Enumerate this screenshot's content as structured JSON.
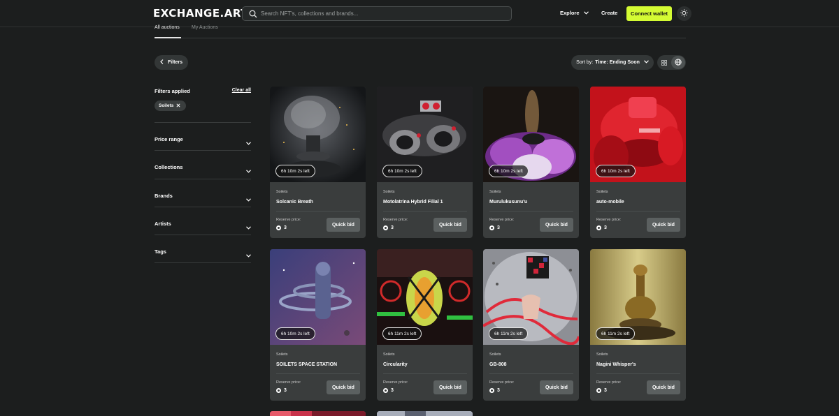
{
  "header": {
    "logo": "EXCHANGE.ART",
    "search_placeholder": "Search NFT's, collections and brands...",
    "nav_explore": "Explore",
    "nav_create": "Create",
    "connect_wallet": "Connect wallet",
    "icons": [
      "search-icon",
      "chevron-down-icon",
      "sun-icon"
    ]
  },
  "tabs": [
    {
      "label": "All auctions",
      "active": true
    },
    {
      "label": "My Auctions",
      "active": false
    }
  ],
  "toolbar": {
    "filters_label": "Filters",
    "sort_prefix": "Sort by:",
    "sort_value": "Time: Ending Soon",
    "view_modes": [
      "grid-icon",
      "globe-icon"
    ]
  },
  "sidebar": {
    "filters_applied": "Filters applied",
    "clear_all": "Clear all",
    "chip": "Soilets",
    "sections": [
      "Price range",
      "Collections",
      "Brands",
      "Artists",
      "Tags"
    ]
  },
  "cards": [
    {
      "timer": "6h 10m 2s left",
      "collection": "Soilets",
      "name": "Solcanic Breath",
      "reserve_label": "Reserve price:",
      "price": "3",
      "button": "Quick bid"
    },
    {
      "timer": "6h 10m 2s left",
      "collection": "Soilets",
      "name": "Motolatrina Hybrid Filial 1",
      "reserve_label": "Reserve price:",
      "price": "3",
      "button": "Quick bid"
    },
    {
      "timer": "6h 10m 2s left",
      "collection": "Soilets",
      "name": "Murulukusunu'u",
      "reserve_label": "Reserve price:",
      "price": "3",
      "button": "Quick bid"
    },
    {
      "timer": "6h 10m 2s left",
      "collection": "Soilets",
      "name": "auto-mobile",
      "reserve_label": "Reserve price:",
      "price": "3",
      "button": "Quick bid"
    },
    {
      "timer": "6h 10m 2s left",
      "collection": "Soilets",
      "name": "SOILETS SPACE STATION",
      "reserve_label": "Reserve price:",
      "price": "3",
      "button": "Quick bid"
    },
    {
      "timer": "6h 11m 2s left",
      "collection": "Soilets",
      "name": "Circularity",
      "reserve_label": "Reserve price:",
      "price": "3",
      "button": "Quick bid"
    },
    {
      "timer": "6h 11m 2s left",
      "collection": "Soilets",
      "name": "GB-808",
      "reserve_label": "Reserve price:",
      "price": "3",
      "button": "Quick bid"
    },
    {
      "timer": "6h 11m 2s left",
      "collection": "Soilets",
      "name": "Nagini Whisper's",
      "reserve_label": "Reserve price:",
      "price": "3",
      "button": "Quick bid"
    }
  ],
  "colors": {
    "background": "#1c1e1e",
    "card": "#3a3d3d",
    "accent": "#d4fb33",
    "button": "#5b6060"
  }
}
